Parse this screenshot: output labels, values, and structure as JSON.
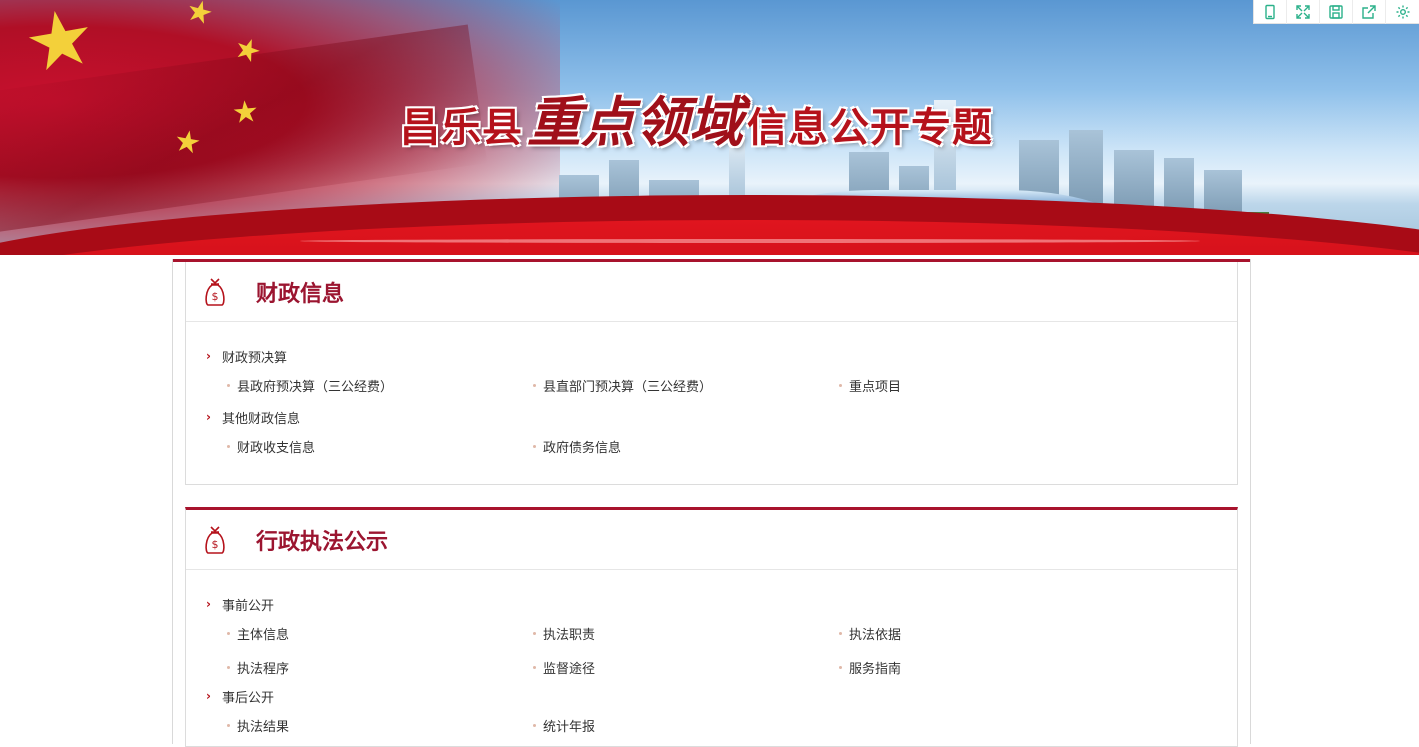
{
  "banner": {
    "title_part1": "昌乐县",
    "title_part2": "重点领域",
    "title_part3": "信息公开专题"
  },
  "toolbar": {
    "tools": [
      {
        "icon": "mobile-icon"
      },
      {
        "icon": "fullscreen-icon"
      },
      {
        "icon": "save-icon"
      },
      {
        "icon": "share-icon"
      },
      {
        "icon": "settings-icon"
      }
    ]
  },
  "colors": {
    "accent": "#a8132d",
    "title": "#9b1530",
    "tool_icon": "#2bb18a"
  },
  "sections": [
    {
      "title": "财政信息",
      "icon": "money-bag-icon",
      "categories": [
        {
          "label": "财政预决算",
          "items": [
            "县政府预决算（三公经费）",
            "县直部门预决算（三公经费）",
            "重点项目"
          ]
        },
        {
          "label": "其他财政信息",
          "items": [
            "财政收支信息",
            "政府债务信息"
          ]
        }
      ]
    },
    {
      "title": "行政执法公示",
      "icon": "money-bag-icon",
      "categories": [
        {
          "label": "事前公开",
          "items": [
            "主体信息",
            "执法职责",
            "执法依据",
            "执法程序",
            "监督途径",
            "服务指南"
          ]
        },
        {
          "label": "事后公开",
          "items": [
            "执法结果",
            "统计年报"
          ]
        }
      ]
    }
  ]
}
